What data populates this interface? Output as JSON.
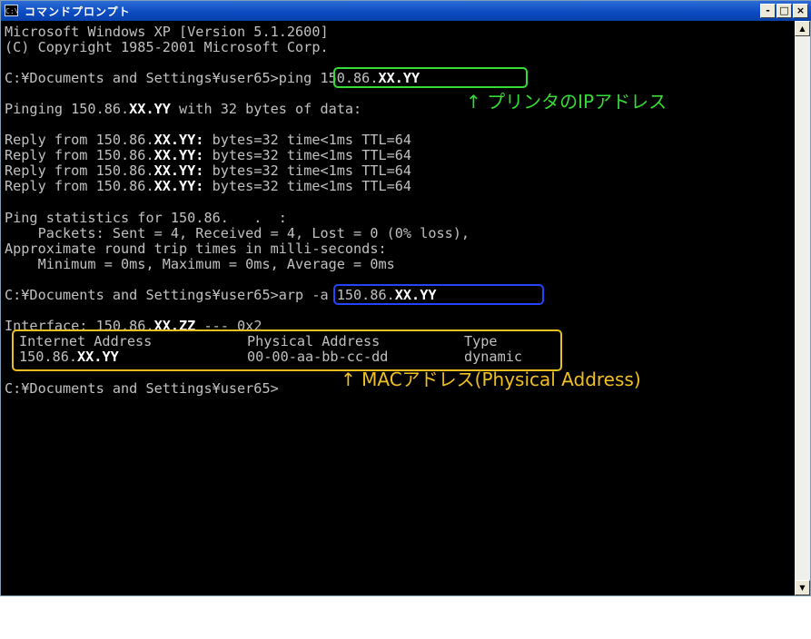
{
  "window": {
    "title": "コマンドプロンプト",
    "icon_label": "C:\\",
    "controls": {
      "minimize": "-",
      "maximize": "□",
      "close": "×"
    }
  },
  "terminal": {
    "banner_line1": "Microsoft Windows XP [Version 5.1.2600]",
    "banner_line2": "(C) Copyright 1985-2001 Microsoft Corp.",
    "prompt": "C:¥Documents and Settings¥user65>",
    "ping_cmd": "ping 150.86.",
    "ping_cmd_hidden": "XX.YY",
    "pinging_prefix": "Pinging 150.86.",
    "pinging_hidden": "XX.YY",
    "pinging_suffix": " with 32 bytes of data:",
    "reply_prefix": "Reply from 150.86.",
    "reply_hidden": "XX.YY:",
    "reply_suffix": " bytes=32 time<1ms TTL=64",
    "stats_line1": "Ping statistics for 150.86.   .  :",
    "stats_line2": "    Packets: Sent = 4, Received = 4, Lost = 0 (0% loss),",
    "stats_line3": "Approximate round trip times in milli-seconds:",
    "stats_line4": "    Minimum = 0ms, Maximum = 0ms, Average = 0ms",
    "arp_cmd": "arp -a 150.86.",
    "arp_cmd_hidden": "XX.YY",
    "iface_prefix": "Interface: 150.86.",
    "iface_hidden": "XX.ZZ",
    "iface_suffix": " --- 0x2",
    "arp_headers": [
      "Internet Address",
      "Physical Address",
      "Type"
    ],
    "arp_row_ip_prefix": "150.86.",
    "arp_row_ip_hidden": "XX.YY",
    "arp_row_mac": "00-00-aa-bb-cc-dd",
    "arp_row_type": "dynamic"
  },
  "annotations": {
    "ip_note": "↑ プリンタのIPアドレス",
    "mac_note": "↑ MACアドレス(Physical Address)"
  },
  "colors": {
    "ping_box": "#33dd33",
    "arp_box": "#2244ff",
    "table_box": "#e6c020",
    "ip_note": "#33dd33",
    "mac_note": "#f0c020"
  }
}
